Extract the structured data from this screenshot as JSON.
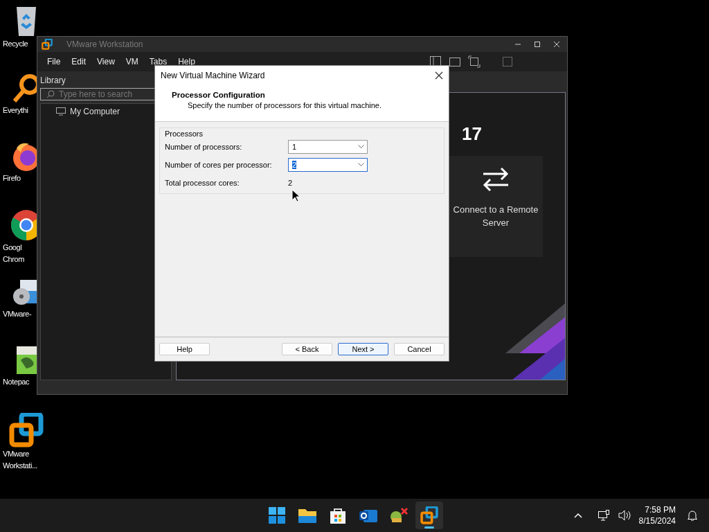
{
  "desktop_icons": [
    {
      "kind": "recycle",
      "lines": [
        "Recycle"
      ]
    },
    {
      "kind": "search",
      "lines": [
        "Everythi"
      ]
    },
    {
      "kind": "firefox",
      "lines": [
        "Firefo"
      ]
    },
    {
      "kind": "chrome",
      "lines": [
        "Googl",
        "Chrom"
      ]
    },
    {
      "kind": "installer",
      "lines": [
        "VMware-"
      ]
    },
    {
      "kind": "notepad",
      "lines": [
        "Notepac"
      ]
    },
    {
      "kind": "vmware",
      "lines": [
        "VMware",
        "Workstati..."
      ]
    }
  ],
  "app_window": {
    "title": "VMware Workstation",
    "menu": [
      "File",
      "Edit",
      "View",
      "VM",
      "Tabs",
      "Help"
    ],
    "library": {
      "title": "Library",
      "search_placeholder": "Type here to search",
      "tree": [
        {
          "label": "My Computer"
        }
      ]
    },
    "home": {
      "version": "17",
      "cards": [
        {
          "label": "Connect to a Remote Server"
        }
      ]
    }
  },
  "dialog": {
    "title": "New Virtual Machine Wizard",
    "heading": "Processor Configuration",
    "subtitle": "Specify the number of processors for this virtual machine.",
    "group": "Processors",
    "rows": [
      {
        "kind": "select",
        "label": "Number of processors:",
        "value": "1",
        "focused": false
      },
      {
        "kind": "select",
        "label": "Number of cores per processor:",
        "value": "2",
        "focused": true
      },
      {
        "kind": "text",
        "label": "Total processor cores:",
        "value": "2"
      }
    ],
    "buttons": [
      {
        "label": "Help",
        "default": false
      },
      {
        "label": "< Back",
        "default": false
      },
      {
        "label": "Next >",
        "default": true
      },
      {
        "label": "Cancel",
        "default": false
      }
    ]
  },
  "taskbar": {
    "apps": [
      {
        "kind": "start",
        "selected": false
      },
      {
        "kind": "folder",
        "selected": false
      },
      {
        "kind": "store",
        "selected": false
      },
      {
        "kind": "mail",
        "selected": false
      },
      {
        "kind": "tool",
        "selected": false
      },
      {
        "kind": "vmware",
        "selected": true
      }
    ],
    "time": "7:58 PM",
    "date": "8/15/2024"
  }
}
